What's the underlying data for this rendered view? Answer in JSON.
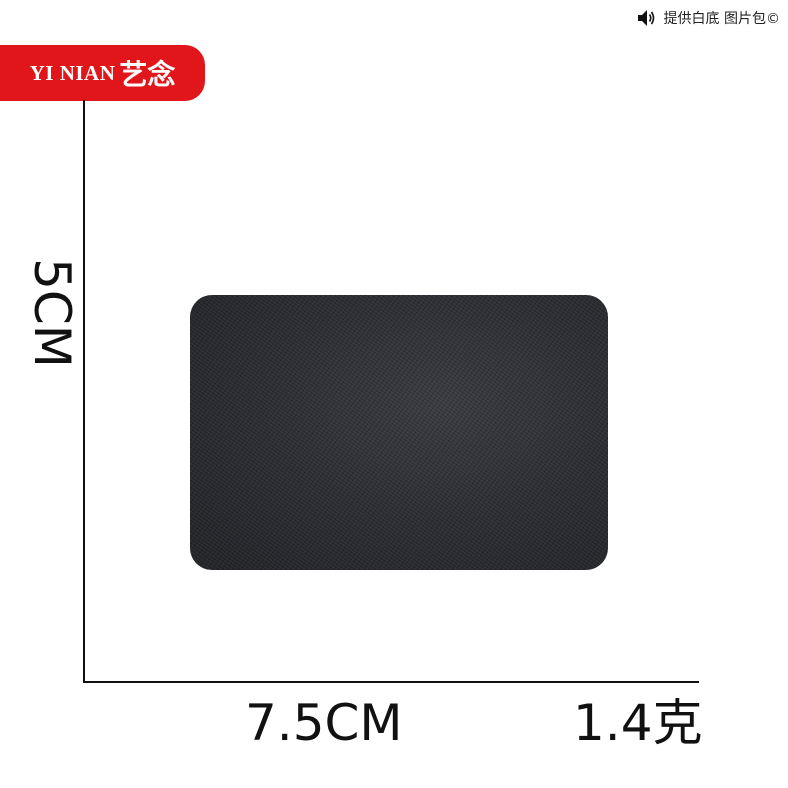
{
  "watermark": {
    "icon": "speaker-icon",
    "text": "提供白底 图片包©"
  },
  "brand": {
    "latin": "YI NIAN",
    "cjk": "艺念",
    "color": "#e0161b"
  },
  "product": {
    "patch_color": "#2a2c30",
    "height_label": "5CM",
    "width_label": "7.5CM",
    "weight_label": "1.4克"
  }
}
